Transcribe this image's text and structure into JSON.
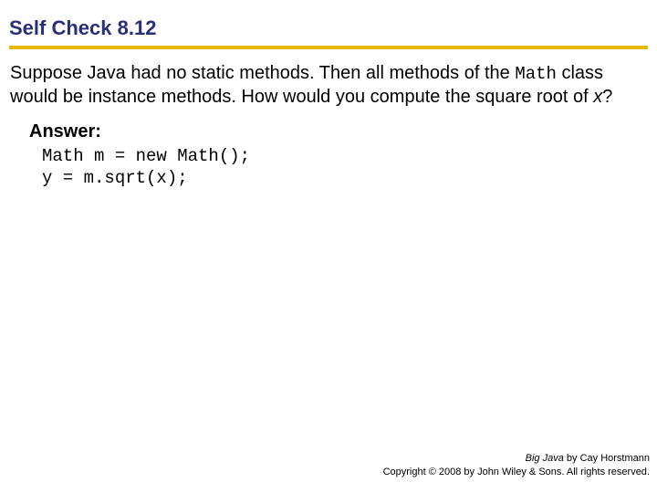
{
  "title": "Self Check 8.12",
  "question": {
    "pre": "Suppose Java had no static methods. Then all methods of the ",
    "codeword": "Math",
    "mid": " class would be instance methods. How would you compute the square root of ",
    "var": "x",
    "post": "?"
  },
  "answer_label": "Answer:",
  "code": "Math m = new Math();\ny = m.sqrt(x);",
  "footer": {
    "book": "Big Java",
    "by": " by Cay Horstmann",
    "copyright": "Copyright © 2008 by John Wiley & Sons. All rights reserved."
  }
}
